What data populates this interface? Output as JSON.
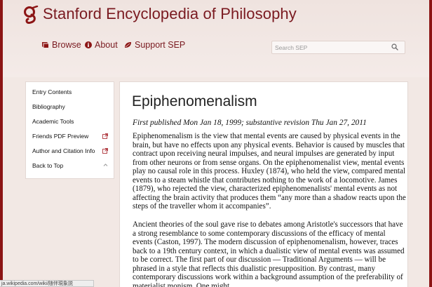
{
  "site": {
    "title": "Stanford Encyclopedia of Philosophy"
  },
  "nav": {
    "browse": "Browse",
    "about": "About",
    "support": "Support SEP"
  },
  "search": {
    "placeholder": "Search SEP"
  },
  "sidebar": {
    "items": [
      {
        "label": "Entry Contents"
      },
      {
        "label": "Bibliography"
      },
      {
        "label": "Academic Tools"
      },
      {
        "label": "Friends PDF Preview"
      },
      {
        "label": "Author and Citation Info"
      },
      {
        "label": "Back to Top"
      }
    ]
  },
  "article": {
    "title": "Epiphenomenalism",
    "pubinfo": "First published Mon Jan 18, 1999; substantive revision Thu Jan 27, 2011",
    "p1": "Epiphenomenalism is the view that mental events are caused by physical events in the brain, but have no effects upon any physical events. Behavior is caused by muscles that contract upon receiving neural impulses, and neural impulses are generated by input from other neurons or from sense organs. On the epiphenomenalist view, mental events play no causal role in this process. Huxley (1874), who held the view, compared mental events to a steam whistle that contributes nothing to the work of a locomotive. James (1879), who rejected the view, characterized epiphenomenalists' mental events as not affecting the brain activity that produces them “any more than a shadow reacts upon the steps of the traveller whom it accompanies”.",
    "p2": "Ancient theories of the soul gave rise to debates among Aristotle's successors that have a strong resemblance to some contemporary discussions of the efficacy of mental events (Caston, 1997). The modern discussion of epiphenomenalism, however, traces back to a 19th century context, in which a dualistic view of mental events was assumed to be correct. The first part of our discussion — Traditional Arguments — will be phrased in a style that reflects this dualistic presupposition. By contrast, many contemporary discussions work within a background assumption of the preferability of materialist monism. One might"
  },
  "status": {
    "url": "ja.wikipedia.com/wiki/随伴現象説"
  },
  "colors": {
    "brand": "#8c1515",
    "link": "#7a1a20",
    "background": "#f2e8e4"
  },
  "icons": {
    "logo": "sep-logo-icon",
    "browse": "book-icon",
    "about": "info-icon",
    "support": "leaf-icon",
    "search": "search-icon",
    "external": "external-link-icon",
    "up": "chevron-up-icon"
  }
}
